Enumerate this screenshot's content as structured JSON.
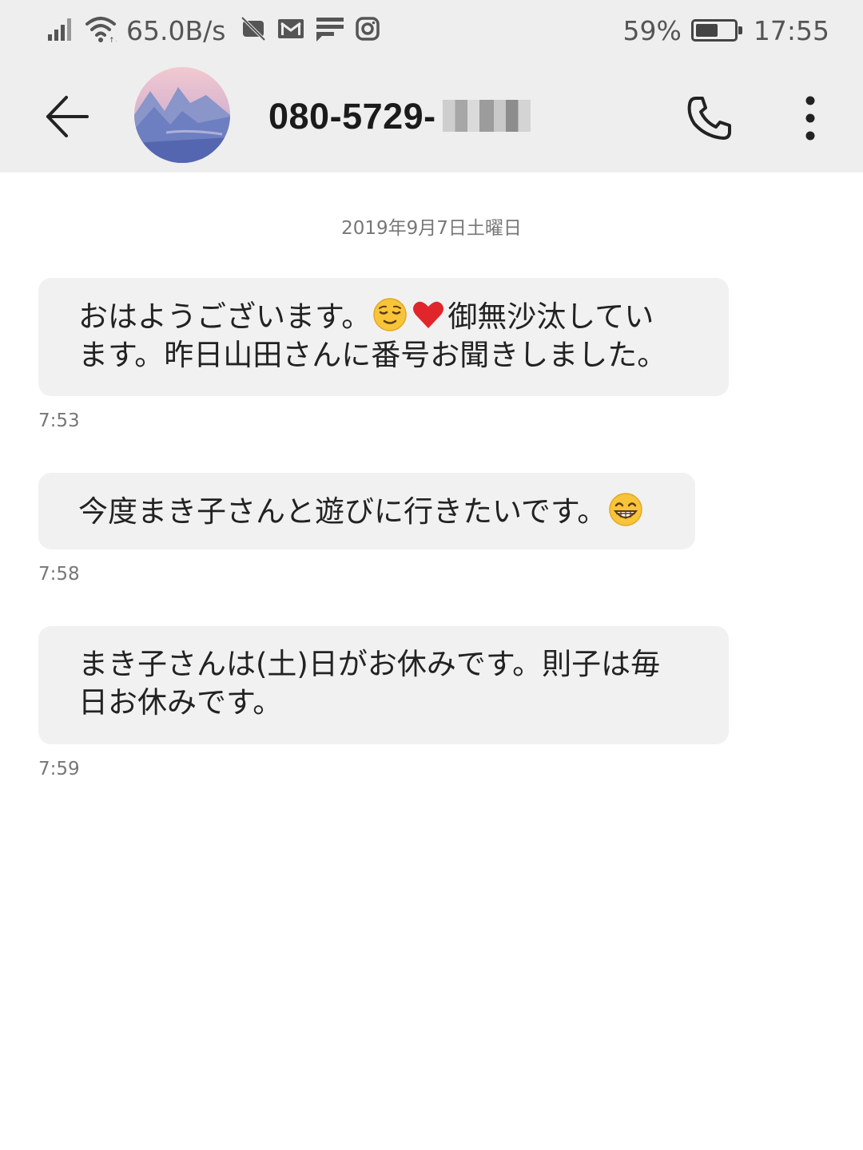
{
  "status_bar": {
    "net_speed": "65.0B/s",
    "battery_percent": "59%",
    "battery_level": 0.59,
    "time": "17:55",
    "icons": [
      "signal-icon",
      "wifi-icon",
      "nfc-off-icon",
      "gmail-icon",
      "message-icon",
      "instagram-icon",
      "battery-icon"
    ]
  },
  "header": {
    "contact_number": "080-5729-",
    "icons": [
      "back-arrow-icon",
      "contact-avatar",
      "phone-icon",
      "more-vert-icon"
    ]
  },
  "conversation": {
    "date": "2019年9月7日土曜日",
    "messages": [
      {
        "part1": "おはようございます。",
        "emoji1": "relieved-face-emoji",
        "emoji2": "red-heart-emoji",
        "line1_rest": "御無沙汰してい",
        "line2": "ます。昨日山田さんに番号お聞きしました。",
        "time": "7:53"
      },
      {
        "text": "今度まき子さんと遊びに行きたいです。",
        "emoji": "grinning-face-emoji",
        "time": "7:58"
      },
      {
        "line1": "まき子さんは(土)日がお休みです。則子は毎",
        "line2": "日お休みです。",
        "time": "7:59"
      }
    ]
  },
  "colors": {
    "header_bg": "#eeeeee",
    "bubble_bg": "#f1f1f1",
    "meta_text": "#777777"
  }
}
